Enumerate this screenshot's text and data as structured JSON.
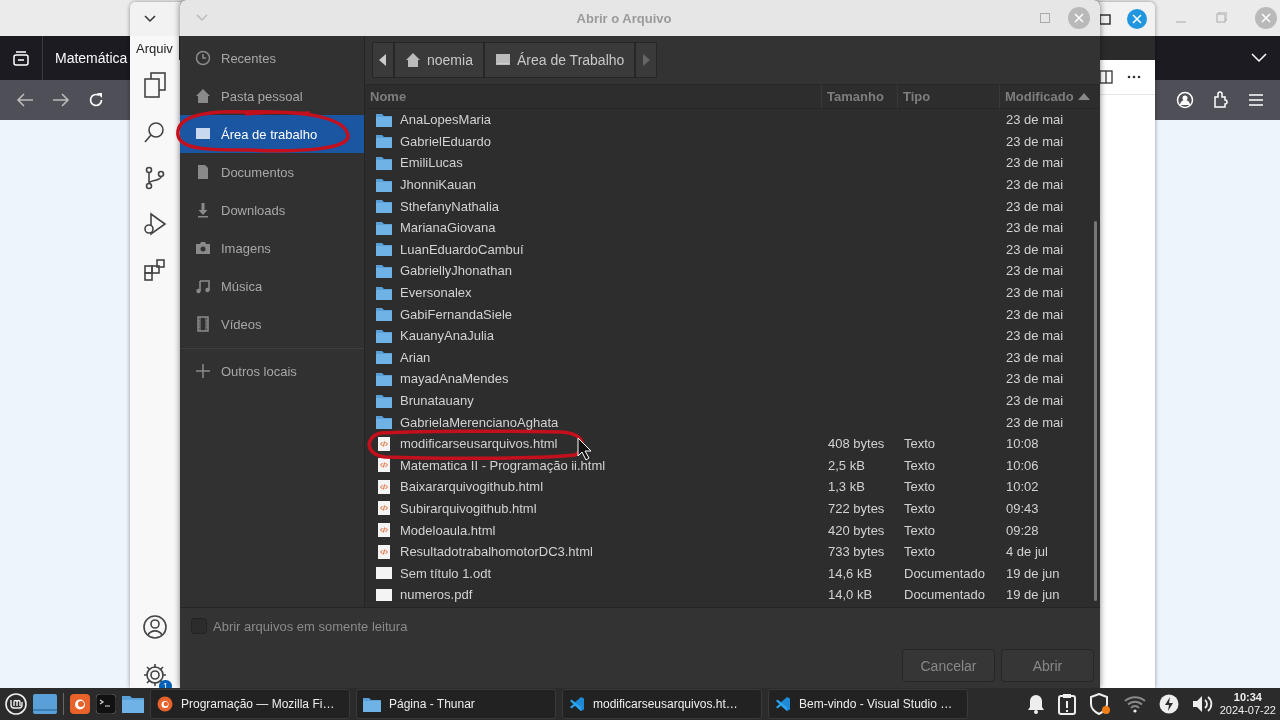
{
  "browser_window": {
    "tab_title": "Matemática"
  },
  "editor_window": {
    "menu_item": "Arquiv",
    "settings_badge": "1"
  },
  "dialog": {
    "title": "Abrir o Arquivo",
    "places": [
      {
        "label": "Recentes",
        "kind": "recent",
        "selected": false
      },
      {
        "label": "Pasta pessoal",
        "kind": "home",
        "selected": false
      },
      {
        "label": "Área de trabalho",
        "kind": "desktop",
        "selected": true
      },
      {
        "label": "Documentos",
        "kind": "document",
        "selected": false
      },
      {
        "label": "Downloads",
        "kind": "download",
        "selected": false
      },
      {
        "label": "Imagens",
        "kind": "image",
        "selected": false
      },
      {
        "label": "Música",
        "kind": "music",
        "selected": false
      },
      {
        "label": "Vídeos",
        "kind": "video",
        "selected": false
      }
    ],
    "other_places": "Outros locais",
    "path": [
      {
        "label": "noemia",
        "kind": "home"
      },
      {
        "label": "Área de Trabalho",
        "kind": "desktop"
      }
    ],
    "columns": [
      {
        "label": "Nome",
        "sorted": false
      },
      {
        "label": "Tamanho",
        "sorted": false
      },
      {
        "label": "Tipo",
        "sorted": false
      },
      {
        "label": "Modificado",
        "sorted": true
      }
    ],
    "rows": [
      {
        "kind": "folder",
        "name": "AnaLopesMaria",
        "modified": "23 de mai"
      },
      {
        "kind": "folder",
        "name": "GabrielEduardo",
        "modified": "23 de mai"
      },
      {
        "kind": "folder",
        "name": "EmiliLucas",
        "modified": "23 de mai"
      },
      {
        "kind": "folder",
        "name": "JhonniKauan",
        "modified": "23 de mai"
      },
      {
        "kind": "folder",
        "name": "SthefanyNathalia",
        "modified": "23 de mai"
      },
      {
        "kind": "folder",
        "name": "MarianaGiovana",
        "modified": "23 de mai"
      },
      {
        "kind": "folder",
        "name": "LuanEduardoCambuí",
        "modified": "23 de mai"
      },
      {
        "kind": "folder",
        "name": "GabriellyJhonathan",
        "modified": "23 de mai"
      },
      {
        "kind": "folder",
        "name": "Eversonalex",
        "modified": "23 de mai"
      },
      {
        "kind": "folder",
        "name": "GabiFernandaSiele",
        "modified": "23 de mai"
      },
      {
        "kind": "folder",
        "name": "KauanyAnaJulia",
        "modified": "23 de mai"
      },
      {
        "kind": "folder",
        "name": "Arian",
        "modified": "23 de mai"
      },
      {
        "kind": "folder",
        "name": "mayadAnaMendes",
        "modified": "23 de mai"
      },
      {
        "kind": "folder",
        "name": "Brunatauany",
        "modified": "23 de mai"
      },
      {
        "kind": "folder",
        "name": "GabrielaMerencianoAghata",
        "modified": "23 de mai"
      },
      {
        "kind": "html",
        "name": "modificarseusarquivos.html",
        "size": "408 bytes",
        "type": "Texto",
        "modified": "10:08"
      },
      {
        "kind": "html",
        "name": "Matematica II - Programação ii.html",
        "size": "2,5 kB",
        "type": "Texto",
        "modified": "10:06"
      },
      {
        "kind": "html",
        "name": "Baixararquivogithub.html",
        "size": "1,3 kB",
        "type": "Texto",
        "modified": "10:02"
      },
      {
        "kind": "html",
        "name": "Subirarquivogithub.html",
        "size": "722 bytes",
        "type": "Texto",
        "modified": "09:43"
      },
      {
        "kind": "html",
        "name": "Modeloaula.html",
        "size": "420 bytes",
        "type": "Texto",
        "modified": "09:28"
      },
      {
        "kind": "html",
        "name": "ResultadotrabalhomotorDC3.html",
        "size": "733 bytes",
        "type": "Texto",
        "modified": "4 de jul"
      },
      {
        "kind": "blank",
        "name": "Sem título 1.odt",
        "size": "14,6 kB",
        "type": "Documentado",
        "modified": "19 de jun"
      },
      {
        "kind": "blank",
        "name": "numeros.pdf",
        "size": "14,0 kB",
        "type": "Documentado",
        "modified": "19 de jun"
      }
    ],
    "read_only": {
      "label": "Abrir arquivos em somente leitura",
      "checked": false
    },
    "buttons": [
      "Cancelar",
      "Abrir"
    ]
  },
  "taskbar": {
    "tasks": [
      {
        "label": "Programação — Mozilla Fi…",
        "kind": "firefox"
      },
      {
        "label": "Página - Thunar",
        "kind": "folder"
      },
      {
        "label": "modificarseusarquivos.ht…",
        "kind": "vscode"
      },
      {
        "label": "Bem-vindo - Visual Studio …",
        "kind": "vscode"
      }
    ],
    "time": "10:34",
    "date": "2024-07-22"
  }
}
